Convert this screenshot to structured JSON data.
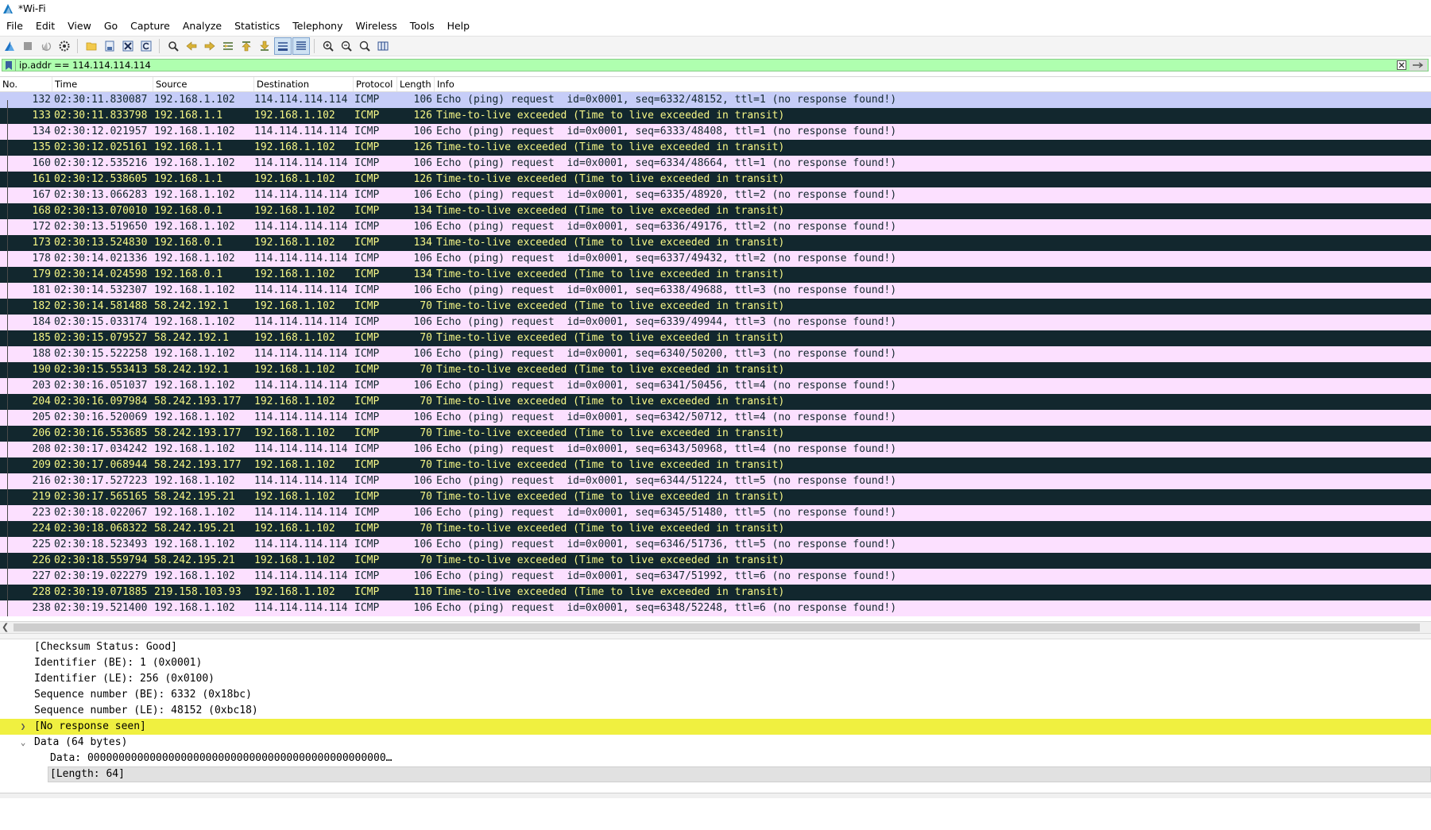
{
  "window": {
    "title": "*Wi-Fi"
  },
  "menu": [
    "File",
    "Edit",
    "View",
    "Go",
    "Capture",
    "Analyze",
    "Statistics",
    "Telephony",
    "Wireless",
    "Tools",
    "Help"
  ],
  "filter": {
    "value": "ip.addr == 114.114.114.114"
  },
  "columns": [
    "No.",
    "Time",
    "Source",
    "Destination",
    "Protocol",
    "Length",
    "Info"
  ],
  "colors": {
    "echo_bg": "#fce0ff",
    "ttl_bg": "#12272e",
    "ttl_fg": "#f7f787",
    "selected_bg": "#c6cdf8",
    "filter_bg": "#afffaf",
    "warn_bg": "#f0f040"
  },
  "packets": [
    {
      "no": "132",
      "time": "02:30:11.830087",
      "src": "192.168.1.102",
      "dst": "114.114.114.114",
      "proto": "ICMP",
      "len": "106",
      "info": "Echo (ping) request  id=0x0001, seq=6332/48152, ttl=1 (no response found!)",
      "type": "selected"
    },
    {
      "no": "133",
      "time": "02:30:11.833798",
      "src": "192.168.1.1",
      "dst": "192.168.1.102",
      "proto": "ICMP",
      "len": "126",
      "info": "Time-to-live exceeded (Time to live exceeded in transit)",
      "type": "ttl"
    },
    {
      "no": "134",
      "time": "02:30:12.021957",
      "src": "192.168.1.102",
      "dst": "114.114.114.114",
      "proto": "ICMP",
      "len": "106",
      "info": "Echo (ping) request  id=0x0001, seq=6333/48408, ttl=1 (no response found!)",
      "type": "echo"
    },
    {
      "no": "135",
      "time": "02:30:12.025161",
      "src": "192.168.1.1",
      "dst": "192.168.1.102",
      "proto": "ICMP",
      "len": "126",
      "info": "Time-to-live exceeded (Time to live exceeded in transit)",
      "type": "ttl"
    },
    {
      "no": "160",
      "time": "02:30:12.535216",
      "src": "192.168.1.102",
      "dst": "114.114.114.114",
      "proto": "ICMP",
      "len": "106",
      "info": "Echo (ping) request  id=0x0001, seq=6334/48664, ttl=1 (no response found!)",
      "type": "echo"
    },
    {
      "no": "161",
      "time": "02:30:12.538605",
      "src": "192.168.1.1",
      "dst": "192.168.1.102",
      "proto": "ICMP",
      "len": "126",
      "info": "Time-to-live exceeded (Time to live exceeded in transit)",
      "type": "ttl"
    },
    {
      "no": "167",
      "time": "02:30:13.066283",
      "src": "192.168.1.102",
      "dst": "114.114.114.114",
      "proto": "ICMP",
      "len": "106",
      "info": "Echo (ping) request  id=0x0001, seq=6335/48920, ttl=2 (no response found!)",
      "type": "echo"
    },
    {
      "no": "168",
      "time": "02:30:13.070010",
      "src": "192.168.0.1",
      "dst": "192.168.1.102",
      "proto": "ICMP",
      "len": "134",
      "info": "Time-to-live exceeded (Time to live exceeded in transit)",
      "type": "ttl"
    },
    {
      "no": "172",
      "time": "02:30:13.519650",
      "src": "192.168.1.102",
      "dst": "114.114.114.114",
      "proto": "ICMP",
      "len": "106",
      "info": "Echo (ping) request  id=0x0001, seq=6336/49176, ttl=2 (no response found!)",
      "type": "echo"
    },
    {
      "no": "173",
      "time": "02:30:13.524830",
      "src": "192.168.0.1",
      "dst": "192.168.1.102",
      "proto": "ICMP",
      "len": "134",
      "info": "Time-to-live exceeded (Time to live exceeded in transit)",
      "type": "ttl"
    },
    {
      "no": "178",
      "time": "02:30:14.021336",
      "src": "192.168.1.102",
      "dst": "114.114.114.114",
      "proto": "ICMP",
      "len": "106",
      "info": "Echo (ping) request  id=0x0001, seq=6337/49432, ttl=2 (no response found!)",
      "type": "echo"
    },
    {
      "no": "179",
      "time": "02:30:14.024598",
      "src": "192.168.0.1",
      "dst": "192.168.1.102",
      "proto": "ICMP",
      "len": "134",
      "info": "Time-to-live exceeded (Time to live exceeded in transit)",
      "type": "ttl"
    },
    {
      "no": "181",
      "time": "02:30:14.532307",
      "src": "192.168.1.102",
      "dst": "114.114.114.114",
      "proto": "ICMP",
      "len": "106",
      "info": "Echo (ping) request  id=0x0001, seq=6338/49688, ttl=3 (no response found!)",
      "type": "echo"
    },
    {
      "no": "182",
      "time": "02:30:14.581488",
      "src": "58.242.192.1",
      "dst": "192.168.1.102",
      "proto": "ICMP",
      "len": "70",
      "info": "Time-to-live exceeded (Time to live exceeded in transit)",
      "type": "ttl"
    },
    {
      "no": "184",
      "time": "02:30:15.033174",
      "src": "192.168.1.102",
      "dst": "114.114.114.114",
      "proto": "ICMP",
      "len": "106",
      "info": "Echo (ping) request  id=0x0001, seq=6339/49944, ttl=3 (no response found!)",
      "type": "echo"
    },
    {
      "no": "185",
      "time": "02:30:15.079527",
      "src": "58.242.192.1",
      "dst": "192.168.1.102",
      "proto": "ICMP",
      "len": "70",
      "info": "Time-to-live exceeded (Time to live exceeded in transit)",
      "type": "ttl"
    },
    {
      "no": "188",
      "time": "02:30:15.522258",
      "src": "192.168.1.102",
      "dst": "114.114.114.114",
      "proto": "ICMP",
      "len": "106",
      "info": "Echo (ping) request  id=0x0001, seq=6340/50200, ttl=3 (no response found!)",
      "type": "echo"
    },
    {
      "no": "190",
      "time": "02:30:15.553413",
      "src": "58.242.192.1",
      "dst": "192.168.1.102",
      "proto": "ICMP",
      "len": "70",
      "info": "Time-to-live exceeded (Time to live exceeded in transit)",
      "type": "ttl"
    },
    {
      "no": "203",
      "time": "02:30:16.051037",
      "src": "192.168.1.102",
      "dst": "114.114.114.114",
      "proto": "ICMP",
      "len": "106",
      "info": "Echo (ping) request  id=0x0001, seq=6341/50456, ttl=4 (no response found!)",
      "type": "echo"
    },
    {
      "no": "204",
      "time": "02:30:16.097984",
      "src": "58.242.193.177",
      "dst": "192.168.1.102",
      "proto": "ICMP",
      "len": "70",
      "info": "Time-to-live exceeded (Time to live exceeded in transit)",
      "type": "ttl"
    },
    {
      "no": "205",
      "time": "02:30:16.520069",
      "src": "192.168.1.102",
      "dst": "114.114.114.114",
      "proto": "ICMP",
      "len": "106",
      "info": "Echo (ping) request  id=0x0001, seq=6342/50712, ttl=4 (no response found!)",
      "type": "echo"
    },
    {
      "no": "206",
      "time": "02:30:16.553685",
      "src": "58.242.193.177",
      "dst": "192.168.1.102",
      "proto": "ICMP",
      "len": "70",
      "info": "Time-to-live exceeded (Time to live exceeded in transit)",
      "type": "ttl"
    },
    {
      "no": "208",
      "time": "02:30:17.034242",
      "src": "192.168.1.102",
      "dst": "114.114.114.114",
      "proto": "ICMP",
      "len": "106",
      "info": "Echo (ping) request  id=0x0001, seq=6343/50968, ttl=4 (no response found!)",
      "type": "echo"
    },
    {
      "no": "209",
      "time": "02:30:17.068944",
      "src": "58.242.193.177",
      "dst": "192.168.1.102",
      "proto": "ICMP",
      "len": "70",
      "info": "Time-to-live exceeded (Time to live exceeded in transit)",
      "type": "ttl"
    },
    {
      "no": "216",
      "time": "02:30:17.527223",
      "src": "192.168.1.102",
      "dst": "114.114.114.114",
      "proto": "ICMP",
      "len": "106",
      "info": "Echo (ping) request  id=0x0001, seq=6344/51224, ttl=5 (no response found!)",
      "type": "echo"
    },
    {
      "no": "219",
      "time": "02:30:17.565165",
      "src": "58.242.195.21",
      "dst": "192.168.1.102",
      "proto": "ICMP",
      "len": "70",
      "info": "Time-to-live exceeded (Time to live exceeded in transit)",
      "type": "ttl"
    },
    {
      "no": "223",
      "time": "02:30:18.022067",
      "src": "192.168.1.102",
      "dst": "114.114.114.114",
      "proto": "ICMP",
      "len": "106",
      "info": "Echo (ping) request  id=0x0001, seq=6345/51480, ttl=5 (no response found!)",
      "type": "echo"
    },
    {
      "no": "224",
      "time": "02:30:18.068322",
      "src": "58.242.195.21",
      "dst": "192.168.1.102",
      "proto": "ICMP",
      "len": "70",
      "info": "Time-to-live exceeded (Time to live exceeded in transit)",
      "type": "ttl"
    },
    {
      "no": "225",
      "time": "02:30:18.523493",
      "src": "192.168.1.102",
      "dst": "114.114.114.114",
      "proto": "ICMP",
      "len": "106",
      "info": "Echo (ping) request  id=0x0001, seq=6346/51736, ttl=5 (no response found!)",
      "type": "echo"
    },
    {
      "no": "226",
      "time": "02:30:18.559794",
      "src": "58.242.195.21",
      "dst": "192.168.1.102",
      "proto": "ICMP",
      "len": "70",
      "info": "Time-to-live exceeded (Time to live exceeded in transit)",
      "type": "ttl"
    },
    {
      "no": "227",
      "time": "02:30:19.022279",
      "src": "192.168.1.102",
      "dst": "114.114.114.114",
      "proto": "ICMP",
      "len": "106",
      "info": "Echo (ping) request  id=0x0001, seq=6347/51992, ttl=6 (no response found!)",
      "type": "echo"
    },
    {
      "no": "228",
      "time": "02:30:19.071885",
      "src": "219.158.103.93",
      "dst": "192.168.1.102",
      "proto": "ICMP",
      "len": "110",
      "info": "Time-to-live exceeded (Time to live exceeded in transit)",
      "type": "ttl"
    },
    {
      "no": "238",
      "time": "02:30:19.521400",
      "src": "192.168.1.102",
      "dst": "114.114.114.114",
      "proto": "ICMP",
      "len": "106",
      "info": "Echo (ping) request  id=0x0001, seq=6348/52248, ttl=6 (no response found!)",
      "type": "echo"
    }
  ],
  "details": {
    "checksum_status": "[Checksum Status: Good]",
    "identifier_be": "Identifier (BE): 1 (0x0001)",
    "identifier_le": "Identifier (LE): 256 (0x0100)",
    "seq_be": "Sequence number (BE): 6332 (0x18bc)",
    "seq_le": "Sequence number (LE): 48152 (0xbc18)",
    "no_response": "[No response seen]",
    "data_header": "Data (64 bytes)",
    "data_value": "Data: 000000000000000000000000000000000000000000000000…",
    "data_length": "[Length: 64]"
  }
}
